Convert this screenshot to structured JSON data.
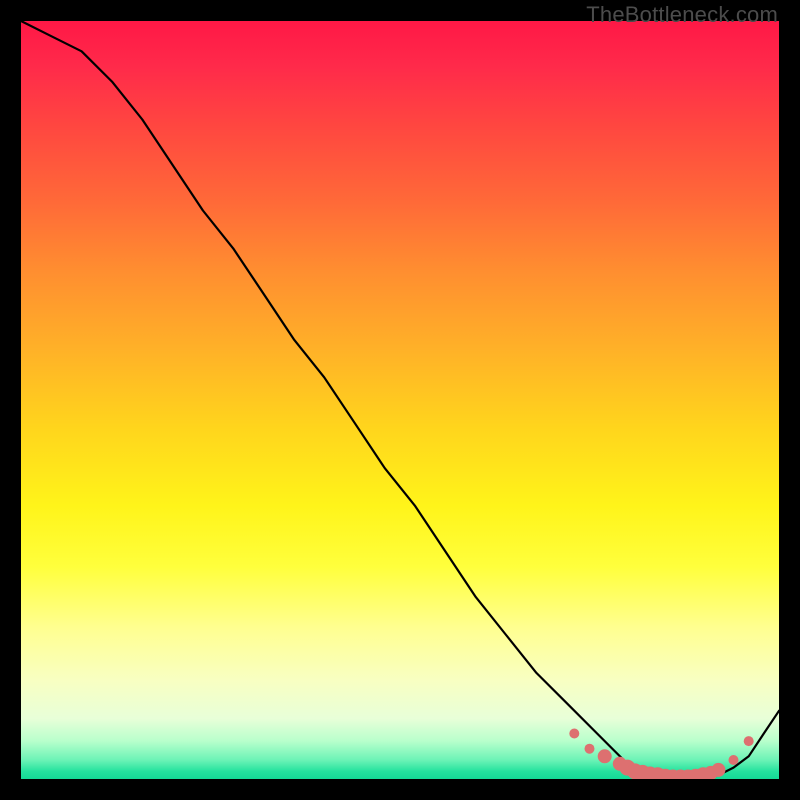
{
  "watermark": "TheBottleneck.com",
  "colors": {
    "curve": "#000000",
    "marker": "#dd7070",
    "background": "#000000"
  },
  "chart_data": {
    "type": "line",
    "title": "",
    "xlabel": "",
    "ylabel": "",
    "xlim": [
      0,
      100
    ],
    "ylim": [
      0,
      100
    ],
    "x": [
      0,
      4,
      8,
      12,
      16,
      20,
      24,
      28,
      32,
      36,
      40,
      44,
      48,
      52,
      56,
      60,
      64,
      68,
      72,
      76,
      80,
      82,
      84,
      86,
      88,
      90,
      92,
      94,
      96,
      98,
      100
    ],
    "y": [
      100,
      98,
      96,
      92,
      87,
      81,
      75,
      70,
      64,
      58,
      53,
      47,
      41,
      36,
      30,
      24,
      19,
      14,
      10,
      6,
      2,
      1,
      0.5,
      0.2,
      0.1,
      0.2,
      0.5,
      1.5,
      3,
      6,
      9
    ],
    "marker_cluster": {
      "x": [
        73,
        75,
        77,
        79,
        80,
        81,
        82,
        83,
        84,
        85,
        86,
        87,
        88,
        89,
        90,
        91,
        92,
        94,
        96
      ],
      "y": [
        6,
        4,
        3,
        2,
        1.5,
        1,
        0.8,
        0.6,
        0.5,
        0.3,
        0.2,
        0.2,
        0.2,
        0.3,
        0.5,
        0.8,
        1.2,
        2.5,
        5
      ]
    }
  }
}
